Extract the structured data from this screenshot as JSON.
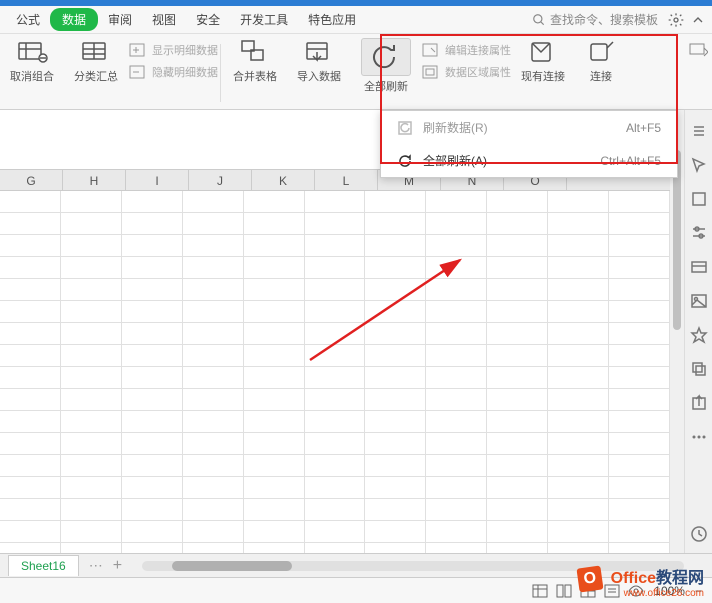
{
  "menubar": {
    "items": [
      "公式",
      "数据",
      "审阅",
      "视图",
      "安全",
      "开发工具",
      "特色应用"
    ],
    "active_index": 1,
    "search_placeholder": "查找命令、搜索模板"
  },
  "ribbon": {
    "ungroup": "取消组合",
    "subtotal": "分类汇总",
    "show_detail": "显示明细数据",
    "hide_detail": "隐藏明细数据",
    "merge_table": "合并表格",
    "import_data": "导入数据",
    "refresh_all": "全部刷新",
    "edit_conn": "编辑连接属性",
    "data_range": "数据区域属性",
    "existing_conn": "现有连接",
    "connect": "连接"
  },
  "dropdown": {
    "row1_label": "刷新数据(R)",
    "row1_shortcut": "Alt+F5",
    "row2_label": "全部刷新(A)",
    "row2_shortcut": "Ctrl+Alt+F5"
  },
  "columns": [
    "G",
    "H",
    "I",
    "J",
    "K",
    "L",
    "M",
    "N",
    "O"
  ],
  "sheet": {
    "active": "Sheet16"
  },
  "status": {
    "zoom": "100%"
  },
  "watermark": {
    "brand1": "Office",
    "brand2": "教程网",
    "url": "www.office26.com"
  }
}
